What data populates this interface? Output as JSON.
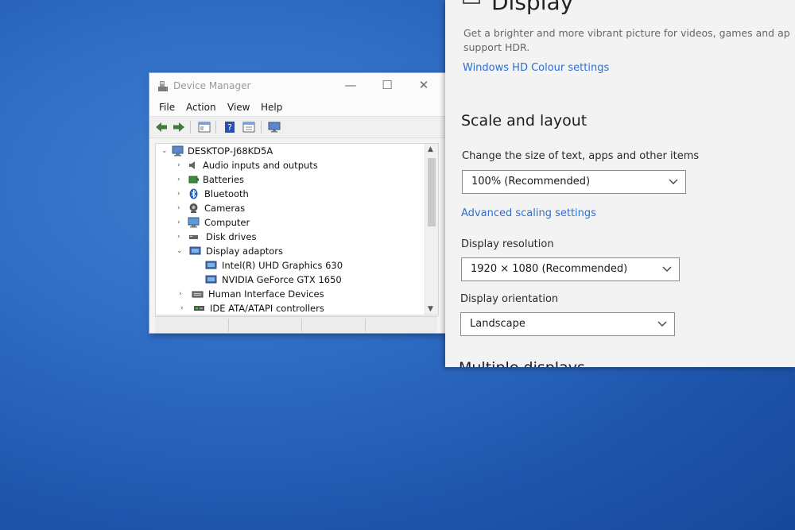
{
  "device_manager": {
    "title": "Device Manager",
    "caption_buttons": {
      "minimize": "—",
      "maximize": "☐",
      "close": "✕"
    },
    "menu": [
      "File",
      "Action",
      "View",
      "Help"
    ],
    "tree": {
      "root": "DESKTOP-J68KD5A",
      "items": [
        {
          "label": "Audio inputs and outputs",
          "icon": "speaker-icon",
          "expanded": false
        },
        {
          "label": "Batteries",
          "icon": "battery-icon",
          "expanded": false
        },
        {
          "label": "Bluetooth",
          "icon": "bluetooth-icon",
          "expanded": false
        },
        {
          "label": "Cameras",
          "icon": "camera-icon",
          "expanded": false
        },
        {
          "label": "Computer",
          "icon": "computer-icon",
          "expanded": false
        },
        {
          "label": "Disk drives",
          "icon": "disk-drive-icon",
          "expanded": false
        },
        {
          "label": "Display adaptors",
          "icon": "display-adapter-icon",
          "expanded": true,
          "children": [
            "Intel(R) UHD Graphics 630",
            "NVIDIA GeForce GTX 1650"
          ]
        },
        {
          "label": "Human Interface Devices",
          "icon": "hid-icon",
          "expanded": false
        },
        {
          "label": "IDE ATA/ATAPI controllers",
          "icon": "ide-controller-icon",
          "expanded": false
        }
      ]
    }
  },
  "settings": {
    "heading": "Display",
    "hdr_description_line1": "Get a brighter and more vibrant picture for videos, games and ap",
    "hdr_description_line2": "support HDR.",
    "hdr_link": "Windows HD Colour settings",
    "section_title": "Scale and layout",
    "scale_label": "Change the size of text, apps and other items",
    "scale_value": "100% (Recommended)",
    "advanced_scaling_link": "Advanced scaling settings",
    "resolution_label": "Display resolution",
    "resolution_value": "1920 × 1080 (Recommended)",
    "orientation_label": "Display orientation",
    "orientation_value": "Landscape",
    "next_section_partial": "Multiple displays"
  },
  "colors": {
    "desktop": "#2f6cc4",
    "link": "#2d6fd0",
    "window_bg": "#f3f3f3"
  }
}
